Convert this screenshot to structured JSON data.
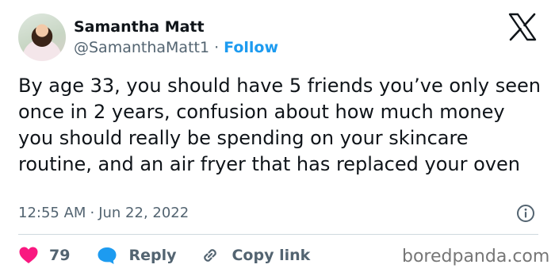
{
  "author": {
    "name": "Samantha Matt",
    "handle": "@SamanthaMatt1",
    "separator": "·",
    "follow_label": "Follow"
  },
  "brand_icon": "x-logo-icon",
  "tweet": {
    "text": "By age 33, you should have 5 friends you’ve only seen once in 2 years, confusion about how much money you should really be spending on your skincare routine, and an air fryer that has replaced your oven",
    "time": "12:55 AM",
    "separator": "·",
    "date": "Jun 22, 2022"
  },
  "actions": {
    "like_count": "79",
    "reply_label": "Reply",
    "copy_link_label": "Copy link"
  },
  "watermark": "boredpanda.com",
  "colors": {
    "accent": "#1d9bf0",
    "like": "#f91880",
    "muted": "#536471",
    "text": "#0f1419",
    "divider": "#cfd9de"
  }
}
